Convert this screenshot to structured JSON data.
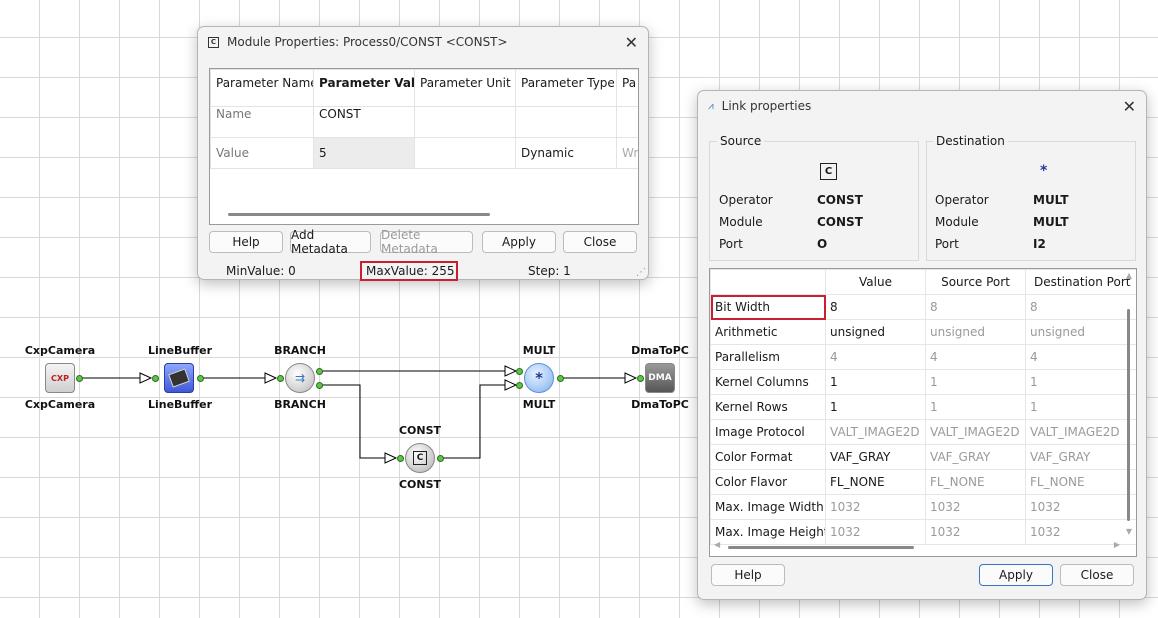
{
  "diagram": {
    "cxp": {
      "top": "CxpCamera",
      "bottom": "CxpCamera"
    },
    "linebuffer": {
      "top": "LineBuffer",
      "bottom": "LineBuffer"
    },
    "branch": {
      "top": "BRANCH",
      "bottom": "BRANCH"
    },
    "mult": {
      "top": "MULT",
      "bottom": "MULT"
    },
    "dma": {
      "top": "DmaToPC",
      "bottom": "DmaToPC"
    },
    "const": {
      "top": "CONST",
      "bottom": "CONST"
    },
    "icons": {
      "cxp": "CXP",
      "dma": "DMA",
      "const": "C",
      "mult": "*"
    }
  },
  "module_dialog": {
    "title": "Module Properties: Process0/CONST <CONST>",
    "columns": [
      "Parameter Name",
      "Parameter Value",
      "Parameter Unit",
      "Parameter Type",
      "Pa"
    ],
    "rows": [
      [
        "Name",
        "CONST",
        "",
        "",
        ""
      ],
      [
        "Value",
        "5",
        "",
        "Dynamic",
        "Writ"
      ]
    ],
    "buttons": {
      "help": "Help",
      "add_metadata": "Add Metadata",
      "delete_metadata": "Delete Metadata",
      "apply": "Apply",
      "close": "Close"
    },
    "status": {
      "min": "MinValue: 0",
      "max": "MaxValue: 255",
      "step": "Step: 1"
    }
  },
  "link_dialog": {
    "title": "Link properties",
    "source": {
      "group": "Source",
      "icon": "C",
      "operator_label": "Operator",
      "operator": "CONST",
      "module_label": "Module",
      "module": "CONST",
      "port_label": "Port",
      "port": "O"
    },
    "destination": {
      "group": "Destination",
      "icon": "*",
      "operator_label": "Operator",
      "operator": "MULT",
      "module_label": "Module",
      "module": "MULT",
      "port_label": "Port",
      "port": "I2"
    },
    "columns": [
      "",
      "Value",
      "Source Port",
      "Destination Port"
    ],
    "rows": [
      {
        "name": "Bit Width",
        "value": "8",
        "src": "8",
        "dst": "8"
      },
      {
        "name": "Arithmetic",
        "value": "unsigned",
        "src": "unsigned",
        "dst": "unsigned"
      },
      {
        "name": "Parallelism",
        "value": "4",
        "src": "4",
        "dst": "4"
      },
      {
        "name": "Kernel Columns",
        "value": "1",
        "src": "1",
        "dst": "1"
      },
      {
        "name": "Kernel Rows",
        "value": "1",
        "src": "1",
        "dst": "1"
      },
      {
        "name": "Image Protocol",
        "value": "VALT_IMAGE2D",
        "src": "VALT_IMAGE2D",
        "dst": "VALT_IMAGE2D"
      },
      {
        "name": "Color Format",
        "value": "VAF_GRAY",
        "src": "VAF_GRAY",
        "dst": "VAF_GRAY"
      },
      {
        "name": "Color Flavor",
        "value": "FL_NONE",
        "src": "FL_NONE",
        "dst": "FL_NONE"
      },
      {
        "name": "Max. Image Width",
        "value": "1032",
        "src": "1032",
        "dst": "1032"
      },
      {
        "name": "Max. Image Height",
        "value": "1032",
        "src": "1032",
        "dst": "1032"
      }
    ],
    "buttons": {
      "help": "Help",
      "apply": "Apply",
      "close": "Close"
    }
  },
  "colors": {
    "highlight": "#c8202e",
    "port": "#5ec447",
    "accent": "#3b73c8"
  }
}
